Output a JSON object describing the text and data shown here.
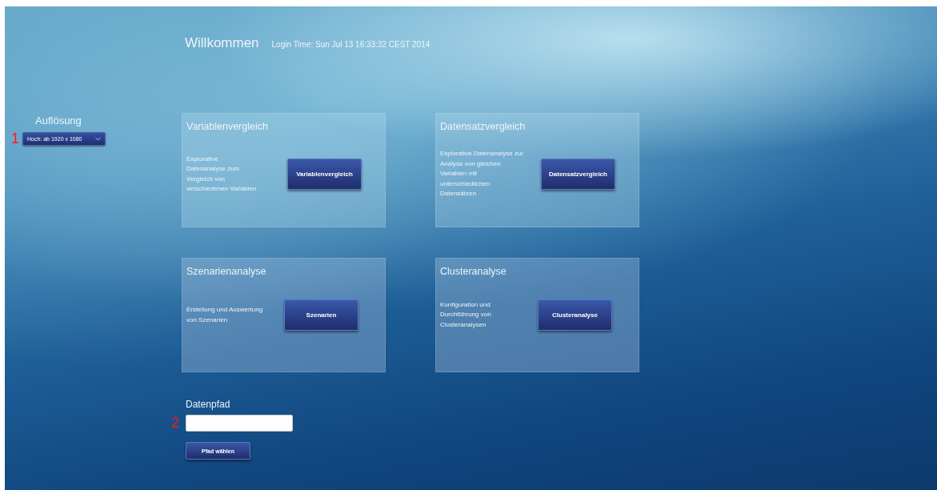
{
  "header": {
    "title": "Willkommen",
    "login_time": "Login Time: Sun Jul 13 16:33:32 CEST 2014"
  },
  "resolution": {
    "label": "Auflösung",
    "value": "Hoch: ab 1920 x 1080"
  },
  "cards": [
    {
      "title": "Variablenvergleich",
      "description": "Explorative Datenanalyse zum Vergleich von verschiedenen Variablen",
      "button": "Variablenvergleich"
    },
    {
      "title": "Datensatzvergleich",
      "description": "Explorative Datenanalyse zur Analyse von gleichen Variablen mit unterschiedlichen Datensätzen",
      "button": "Datensatzvergleich"
    },
    {
      "title": "Szenarienanalyse",
      "description": "Erstellung und Auswertung von Szenarien",
      "button": "Szenarien"
    },
    {
      "title": "Clusteranalyse",
      "description": "Konfiguration und Durchführung von Clusteranalysen",
      "button": "Clusteranalyse"
    }
  ],
  "data_path": {
    "label": "Datenpfad",
    "button": "Pfad wählen"
  },
  "markers": [
    "1",
    "2"
  ]
}
